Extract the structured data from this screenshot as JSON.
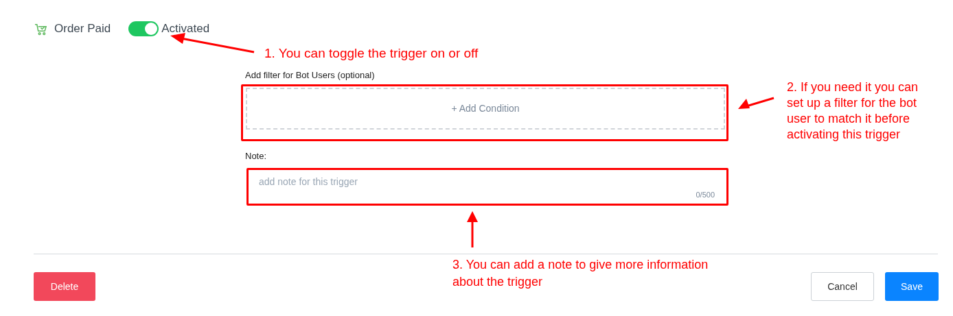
{
  "trigger": {
    "name": "Order Paid",
    "activated": true,
    "status_label": "Activated"
  },
  "filter": {
    "label": "Add filter for Bot Users (optional)",
    "add_button": "+ Add Condition"
  },
  "note": {
    "label": "Note:",
    "placeholder": "add note for this trigger",
    "counter": "0/500"
  },
  "footer": {
    "delete": "Delete",
    "cancel": "Cancel",
    "save": "Save"
  },
  "annotations": [
    {
      "text": "1. You can toggle the trigger on or off"
    },
    {
      "text": "2. If you need it you can\nset up a filter for the bot\nuser to match it before\nactivating this trigger"
    },
    {
      "text": "3. You can add a note to give more information\nabout the trigger"
    }
  ]
}
